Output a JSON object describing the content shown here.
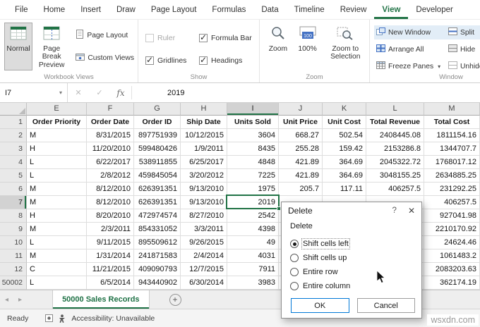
{
  "colors": {
    "accent": "#217346",
    "dialog_default_border": "#0078d7"
  },
  "icons": {
    "dropdown_caret": "▾",
    "cancel": "✕",
    "enter": "✓",
    "fx": "fx",
    "close": "✕",
    "add_sheet": "+",
    "left_arrow": "◂",
    "right_arrow": "▸"
  },
  "ribbon_tabs": [
    {
      "label": "File"
    },
    {
      "label": "Home"
    },
    {
      "label": "Insert"
    },
    {
      "label": "Draw"
    },
    {
      "label": "Page Layout"
    },
    {
      "label": "Formulas"
    },
    {
      "label": "Data"
    },
    {
      "label": "Timeline"
    },
    {
      "label": "Review"
    },
    {
      "label": "View",
      "active": true
    },
    {
      "label": "Developer"
    }
  ],
  "ribbon": {
    "workbook_views": {
      "group_label": "Workbook Views",
      "normal": "Normal",
      "page_break_preview": "Page Break Preview",
      "page_layout": "Page Layout",
      "custom_views": "Custom Views"
    },
    "show": {
      "group_label": "Show",
      "ruler": "Ruler",
      "formula_bar": "Formula Bar",
      "gridlines": "Gridlines",
      "headings": "Headings"
    },
    "zoom": {
      "group_label": "Zoom",
      "zoom": "Zoom",
      "pct": "100%",
      "zoom_to_selection": "Zoom to Selection"
    },
    "window": {
      "group_label": "Window",
      "new_window": "New Window",
      "arrange_all": "Arrange All",
      "freeze_panes": "Freeze Panes",
      "split": "Split",
      "hide": "Hide",
      "unhide": "Unhide"
    }
  },
  "formula_bar": {
    "name_box": "I7",
    "value": "2019"
  },
  "grid": {
    "columns": [
      "E",
      "F",
      "G",
      "H",
      "I",
      "J",
      "K",
      "L",
      "M"
    ],
    "selected_column": "I",
    "selected_row": "7",
    "header_row": [
      "Order Priority",
      "Order Date",
      "Order ID",
      "Ship Date",
      "Units Sold",
      "Unit Price",
      "Unit Cost",
      "Total Revenue",
      "Total Cost"
    ],
    "rows": [
      {
        "n": "2",
        "cells": [
          "M",
          "8/31/2015",
          "897751939",
          "10/12/2015",
          "3604",
          "668.27",
          "502.54",
          "2408445.08",
          "1811154.16"
        ]
      },
      {
        "n": "3",
        "cells": [
          "H",
          "11/20/2010",
          "599480426",
          "1/9/2011",
          "8435",
          "255.28",
          "159.42",
          "2153286.8",
          "1344707.7"
        ]
      },
      {
        "n": "4",
        "cells": [
          "L",
          "6/22/2017",
          "538911855",
          "6/25/2017",
          "4848",
          "421.89",
          "364.69",
          "2045322.72",
          "1768017.12"
        ]
      },
      {
        "n": "5",
        "cells": [
          "L",
          "2/8/2012",
          "459845054",
          "3/20/2012",
          "7225",
          "421.89",
          "364.69",
          "3048155.25",
          "2634885.25"
        ]
      },
      {
        "n": "6",
        "cells": [
          "M",
          "8/12/2010",
          "626391351",
          "9/13/2010",
          "1975",
          "205.7",
          "117.11",
          "406257.5",
          "231292.25"
        ]
      },
      {
        "n": "7",
        "cells": [
          "M",
          "8/12/2010",
          "626391351",
          "9/13/2010",
          "2019",
          "",
          "",
          "",
          "406257.5"
        ],
        "selected": true
      },
      {
        "n": "8",
        "cells": [
          "H",
          "8/20/2010",
          "472974574",
          "8/27/2010",
          "2542",
          "",
          "",
          "",
          "927041.98"
        ]
      },
      {
        "n": "9",
        "cells": [
          "M",
          "2/3/2011",
          "854331052",
          "3/3/2011",
          "4398",
          "",
          "",
          "",
          "2210170.92"
        ]
      },
      {
        "n": "10",
        "cells": [
          "L",
          "9/11/2015",
          "895509612",
          "9/26/2015",
          "49",
          "",
          "",
          "",
          "24624.46"
        ]
      },
      {
        "n": "11",
        "cells": [
          "M",
          "1/31/2014",
          "241871583",
          "2/4/2014",
          "4031",
          "",
          "",
          "",
          "1061483.2"
        ]
      },
      {
        "n": "12",
        "cells": [
          "C",
          "11/21/2015",
          "409090793",
          "12/7/2015",
          "7911",
          "",
          "",
          "",
          "2083203.63"
        ]
      },
      {
        "n": "50002",
        "cells": [
          "L",
          "6/5/2014",
          "943440902",
          "6/30/2014",
          "3983",
          "",
          "",
          "",
          "362174.19"
        ]
      }
    ]
  },
  "dialog": {
    "title": "Delete",
    "help": "?",
    "group_label": "Delete",
    "options": [
      {
        "label": "Shift cells left",
        "selected": true
      },
      {
        "label": "Shift cells up",
        "selected": false
      },
      {
        "label": "Entire row",
        "selected": false
      },
      {
        "label": "Entire column",
        "selected": false
      }
    ],
    "ok": "OK",
    "cancel": "Cancel"
  },
  "sheet_tabs": {
    "active": "50000 Sales Records"
  },
  "status_bar": {
    "ready": "Ready",
    "accessibility": "Accessibility: Unavailable"
  },
  "watermark": "wsxdn.com"
}
